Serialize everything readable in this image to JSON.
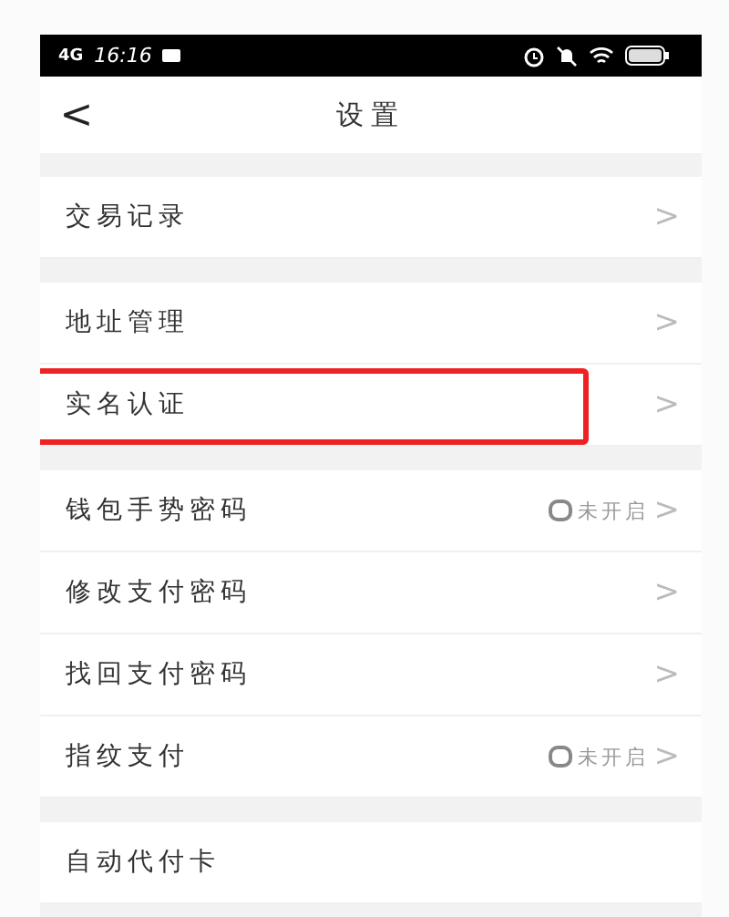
{
  "status_bar": {
    "network": "4G",
    "time": "16:16"
  },
  "nav": {
    "back": "<",
    "title": "设置"
  },
  "groups": [
    {
      "rows": [
        {
          "label": "交易记录",
          "chevron": ">",
          "highlighted": false
        }
      ]
    },
    {
      "rows": [
        {
          "label": "地址管理",
          "chevron": ">",
          "highlighted": false
        },
        {
          "label": "实名认证",
          "chevron": ">",
          "highlighted": true
        }
      ]
    },
    {
      "rows": [
        {
          "label": "钱包手势密码",
          "status": "未开启",
          "chevron": ">",
          "highlighted": false
        },
        {
          "label": "修改支付密码",
          "chevron": ">",
          "highlighted": false
        },
        {
          "label": "找回支付密码",
          "chevron": ">",
          "highlighted": false
        },
        {
          "label": "指纹支付",
          "status": "未开启",
          "chevron": ">",
          "highlighted": false
        }
      ]
    },
    {
      "rows": [
        {
          "label": "自动代付卡",
          "highlighted": false
        }
      ]
    }
  ]
}
